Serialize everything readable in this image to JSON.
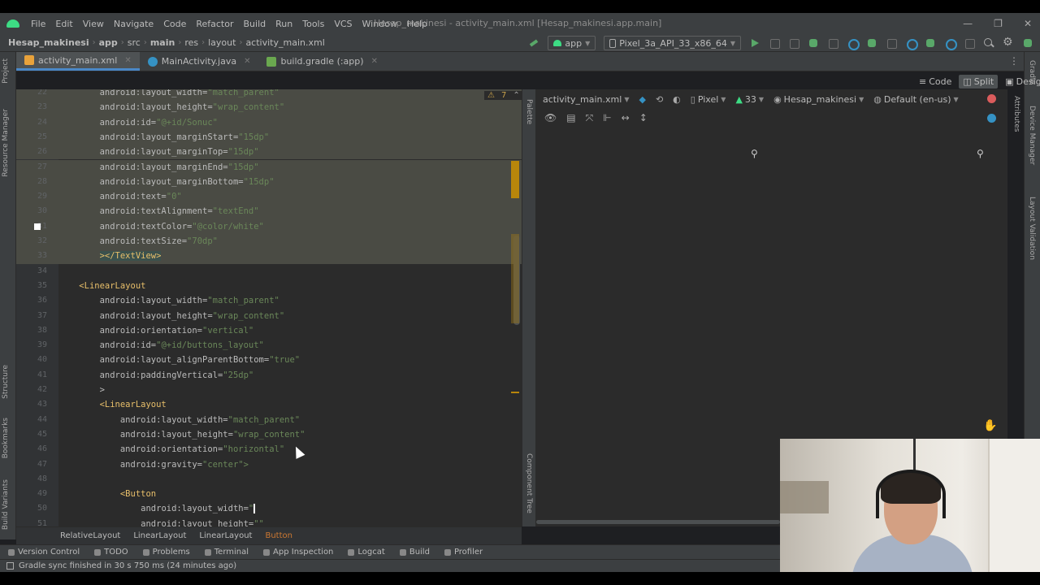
{
  "menubar": {
    "items": [
      "File",
      "Edit",
      "View",
      "Navigate",
      "Code",
      "Refactor",
      "Build",
      "Run",
      "Tools",
      "VCS",
      "Window",
      "Help"
    ],
    "window_title": "Hesap_makinesi - activity_main.xml [Hesap_makinesi.app.main]"
  },
  "nav": {
    "breadcrumbs": [
      "Hesap_makinesi",
      "app",
      "src",
      "main",
      "res",
      "layout",
      "activity_main.xml"
    ],
    "run_config": "app",
    "device": "Pixel_3a_API_33_x86_64"
  },
  "tabs": [
    {
      "label": "activity_main.xml",
      "color": "#e8a23b",
      "active": true
    },
    {
      "label": "MainActivity.java",
      "color": "#3592c4",
      "active": false
    },
    {
      "label": "build.gradle (:app)",
      "color": "#6aa84f",
      "active": false
    }
  ],
  "view_modes": {
    "code": "Code",
    "split": "Split",
    "design": "Design"
  },
  "editor": {
    "warning_count": "7",
    "lines": [
      {
        "n": "22",
        "ns": "android:layout_width=",
        "val": "\"match_parent\"",
        "sel": true,
        "indent": "        "
      },
      {
        "n": "23",
        "ns": "android:layout_height=",
        "val": "\"wrap_content\"",
        "sel": true,
        "indent": "        "
      },
      {
        "n": "24",
        "ns": "android:id=",
        "val": "\"@+id/Sonuc\"",
        "sel": true,
        "indent": "        "
      },
      {
        "n": "25",
        "ns": "android:layout_marginStart=",
        "val": "\"15dp\"",
        "sel": true,
        "indent": "        "
      },
      {
        "n": "26",
        "ns": "android:layout_marginTop=",
        "val": "\"15dp\"",
        "sel": true,
        "indent": "        "
      },
      {
        "n": "27",
        "ns": "android:layout_marginEnd=",
        "val": "\"15dp\"",
        "sel": true,
        "indent": "        "
      },
      {
        "n": "28",
        "ns": "android:layout_marginBottom=",
        "val": "\"15dp\"",
        "sel": true,
        "indent": "        "
      },
      {
        "n": "29",
        "ns": "android:text=",
        "val": "\"0\"",
        "sel": true,
        "indent": "        "
      },
      {
        "n": "30",
        "ns": "android:textAlignment=",
        "val": "\"textEnd\"",
        "sel": true,
        "indent": "        "
      },
      {
        "n": "31",
        "ns": "android:textColor=",
        "val": "\"@color/white\"",
        "sel": true,
        "indent": "        "
      },
      {
        "n": "32",
        "ns": "android:textSize=",
        "val": "\"70dp\"",
        "sel": true,
        "indent": "        "
      },
      {
        "n": "33",
        "tag": "></TextView>",
        "sel": true,
        "indent": "        ",
        "hl": true
      },
      {
        "n": "34",
        "ns": "",
        "val": "",
        "sel": false,
        "indent": ""
      },
      {
        "n": "35",
        "tag": "<LinearLayout",
        "sel": false,
        "indent": "    "
      },
      {
        "n": "36",
        "ns": "android:layout_width=",
        "val": "\"match_parent\"",
        "sel": false,
        "indent": "        "
      },
      {
        "n": "37",
        "ns": "android:layout_height=",
        "val": "\"wrap_content\"",
        "sel": false,
        "indent": "        "
      },
      {
        "n": "38",
        "ns": "android:orientation=",
        "val": "\"vertical\"",
        "sel": false,
        "indent": "        "
      },
      {
        "n": "39",
        "ns": "android:id=",
        "val": "\"@+id/buttons_layout\"",
        "sel": false,
        "indent": "        "
      },
      {
        "n": "40",
        "ns": "android:layout_alignParentBottom=",
        "val": "\"true\"",
        "sel": false,
        "indent": "        "
      },
      {
        "n": "41",
        "ns": "android:paddingVertical=",
        "val": "\"25dp\"",
        "sel": false,
        "indent": "        "
      },
      {
        "n": "42",
        "ns": ">",
        "val": "",
        "sel": false,
        "indent": "        "
      },
      {
        "n": "43",
        "tag": "<LinearLayout",
        "sel": false,
        "indent": "        "
      },
      {
        "n": "44",
        "ns": "android:layout_width=",
        "val": "\"match_parent\"",
        "sel": false,
        "indent": "            "
      },
      {
        "n": "45",
        "ns": "android:layout_height=",
        "val": "\"wrap_content\"",
        "sel": false,
        "indent": "            "
      },
      {
        "n": "46",
        "ns": "android:orientation=",
        "val": "\"horizontal\"",
        "sel": false,
        "indent": "            "
      },
      {
        "n": "47",
        "ns": "android:gravity=",
        "val": "\"center\">",
        "sel": false,
        "indent": "            "
      },
      {
        "n": "48",
        "ns": "",
        "val": "",
        "sel": false,
        "indent": ""
      },
      {
        "n": "49",
        "tag": "<Button",
        "sel": false,
        "indent": "            "
      },
      {
        "n": "50",
        "ns": "android:layout_width=",
        "val": "\"",
        "sel": false,
        "indent": "                ",
        "caret": true
      },
      {
        "n": "51",
        "ns": "android:layout_height=",
        "val": "\"\"",
        "sel": false,
        "indent": "                "
      }
    ]
  },
  "xml_breadcrumbs": [
    "RelativeLayout",
    "LinearLayout",
    "LinearLayout",
    "Button"
  ],
  "side_tabs": {
    "left": [
      "Project",
      "Resource Manager",
      "Structure",
      "Bookmarks",
      "Build Variants"
    ],
    "right": [
      "Gradle",
      "Device Manager",
      "Layout Validation"
    ],
    "palette": "Palette",
    "component_tree": "Component Tree",
    "attributes": "Attributes"
  },
  "design": {
    "file": "activity_main.xml",
    "device": "Pixel",
    "api": "33",
    "theme": "Hesap_makinesi",
    "locale": "Default (en-us)"
  },
  "bottom_tools": [
    "Version Control",
    "TODO",
    "Problems",
    "Terminal",
    "App Inspection",
    "Logcat",
    "Build",
    "Profiler"
  ],
  "status": {
    "text": "Gradle sync finished in 30 s 750 ms (24 minutes ago)"
  }
}
